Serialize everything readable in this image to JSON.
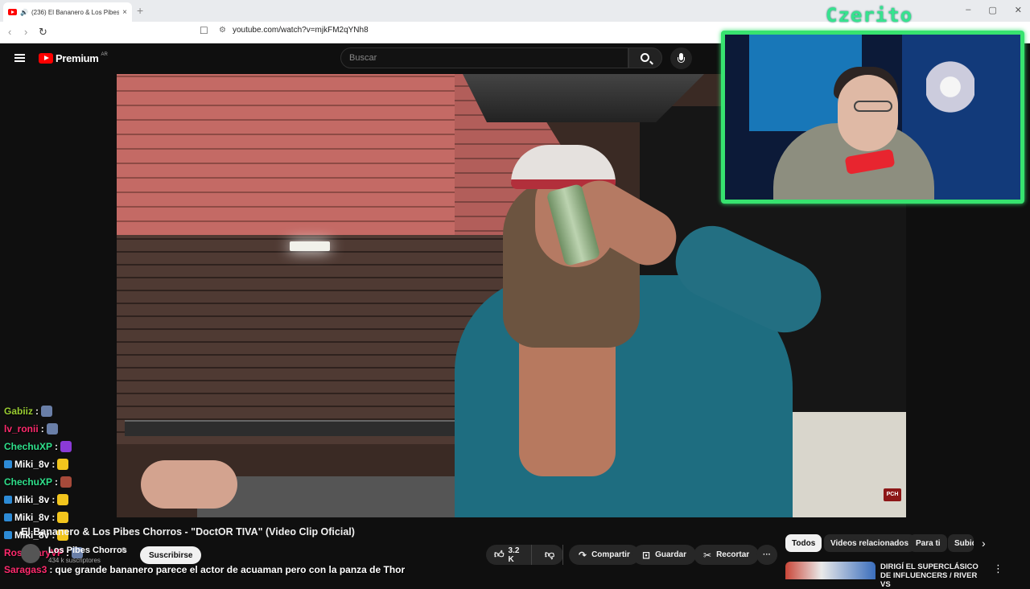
{
  "browser": {
    "tab_title": "(236) El Bananero & Los Pibes",
    "close": "×",
    "new_tab": "+",
    "url": "youtube.com/watch?v=mjkFM2qYNh8",
    "window_controls": [
      "–",
      "▢",
      "✕"
    ]
  },
  "header": {
    "logo_text": "Premium",
    "country": "AR",
    "search_placeholder": "Buscar"
  },
  "webcam": {
    "streamer_name": "Czerito",
    "frame_color": "#37e36f"
  },
  "video": {
    "watermark": "PCH"
  },
  "chat": [
    {
      "user": "Gabiiz",
      "color": "#9acd32",
      "sep": " :",
      "msg": "",
      "badge": false,
      "emote": "#6a7fa8"
    },
    {
      "user": "lv_ronii",
      "color": "#ff2a6d",
      "sep": " :",
      "msg": "",
      "badge": false,
      "emote": "#6a7fa8"
    },
    {
      "user": "ChechuXP",
      "color": "#2fe08b",
      "sep": " :",
      "msg": "",
      "badge": false,
      "emote": "#8a3ad6"
    },
    {
      "user": "Miki_8v",
      "color": "#ffffff",
      "sep": " :",
      "msg": "",
      "badge": true,
      "emote": "#f2c51d"
    },
    {
      "user": "ChechuXP",
      "color": "#2fe08b",
      "sep": " :",
      "msg": "",
      "badge": false,
      "emote": "#a64a3a"
    },
    {
      "user": "Miki_8v",
      "color": "#ffffff",
      "sep": " :",
      "msg": "",
      "badge": true,
      "emote": "#f2c51d"
    },
    {
      "user": "Miki_8v",
      "color": "#ffffff",
      "sep": " :",
      "msg": "",
      "badge": true,
      "emote": "#f2c51d"
    },
    {
      "user": "Miki_8v",
      "color": "#ffffff",
      "sep": " :",
      "msg": "",
      "badge": true,
      "emote": "#f2c51d"
    },
    {
      "user": "RosemaryVP",
      "color": "#ff2a6d",
      "sep": " :",
      "msg": "",
      "badge": false,
      "emote": "#6a7fa8"
    },
    {
      "user": "Saragas3",
      "color": "#ff2a6d",
      "sep": " :",
      "msg": "que grande bananero parece el actor de acuaman pero con la panza de Thor",
      "badge": false,
      "emote": ""
    }
  ],
  "video_info": {
    "title": "El Bananero & Los Pibes Chorros - \"DoctOR TIVA\" (Video Clip Oficial)",
    "channel": "Los Pibes Chorros",
    "verified": "⊘",
    "subscribers": "434 k suscriptores",
    "subscribe_label": "Suscribirse"
  },
  "actions": {
    "likes": "3.2 K",
    "share": "Compartir",
    "save": "Guardar",
    "clip": "Recortar",
    "more": "···"
  },
  "chips": [
    "Todos",
    "Videos relacionados",
    "Para ti",
    "Subidos"
  ],
  "related": {
    "title": "DIRIGÍ EL SUPERCLÁSICO DE INFLUENCERS / RIVER VS",
    "more": "⋮"
  }
}
